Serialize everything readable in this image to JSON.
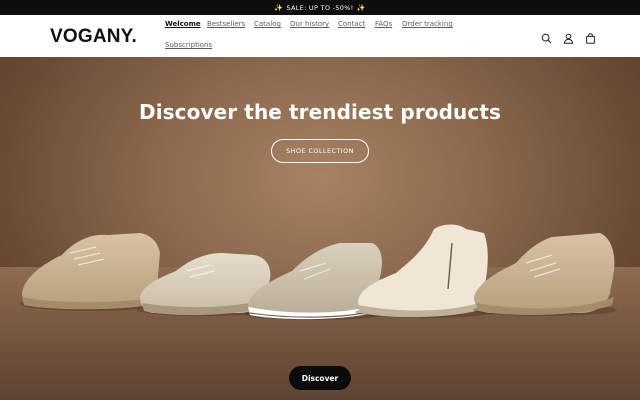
{
  "announcement": {
    "text": "SALE: UP TO -50%!",
    "icon": "sparkles-icon"
  },
  "header": {
    "logo": "VOGANY.",
    "nav": [
      {
        "label": "Welcome",
        "active": true
      },
      {
        "label": "Bestsellers",
        "active": false
      },
      {
        "label": "Catalog",
        "active": false
      },
      {
        "label": "Our history",
        "active": false
      },
      {
        "label": "Contact",
        "active": false
      },
      {
        "label": "FAQs",
        "active": false
      },
      {
        "label": "Order tracking",
        "active": false
      },
      {
        "label": "Subscriptions",
        "active": false
      }
    ],
    "icons": [
      "search-icon",
      "account-icon",
      "cart-icon"
    ]
  },
  "hero": {
    "title": "Discover the trendiest products",
    "collection_button": "SHOE COLLECTION",
    "discover_button": "Discover"
  },
  "colors": {
    "announcement_bg": "#0d0d0d",
    "hero_bg": "#8c6a4e",
    "shoe": "#d8c9b0"
  }
}
